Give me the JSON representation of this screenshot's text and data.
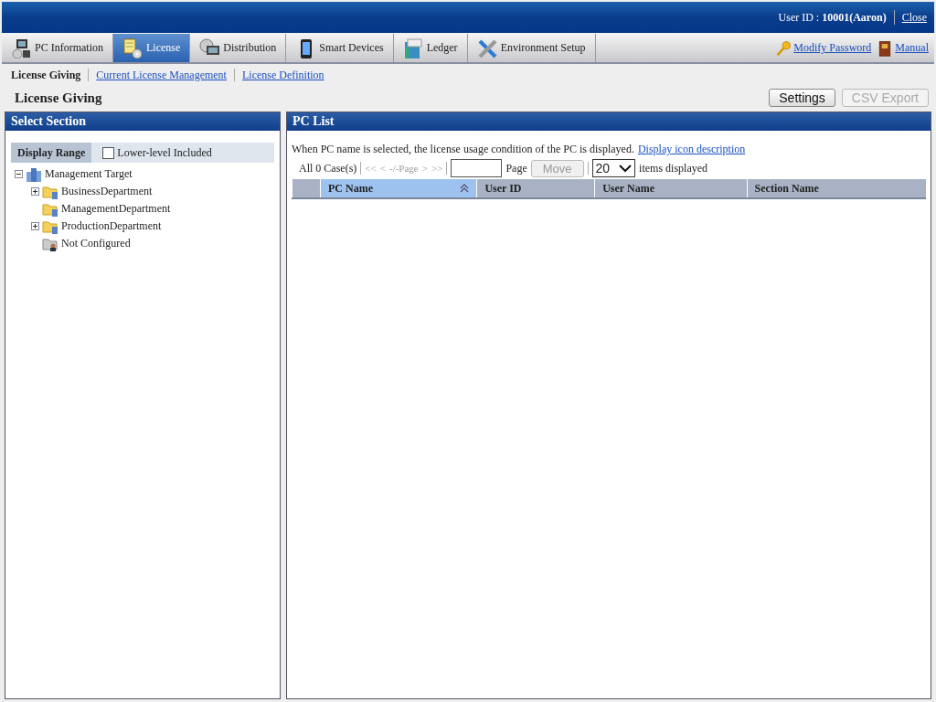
{
  "header": {
    "user": "User ID : **10001(Aaron)**",
    "close_link": "Close"
  },
  "tabs": [
    {
      "label": "PC Information",
      "selected": false
    },
    {
      "label": "License",
      "selected": true
    },
    {
      "label": "Distribution",
      "selected": false
    },
    {
      "label": "Smart Devices",
      "selected": false
    },
    {
      "label": "Ledger",
      "selected": false
    },
    {
      "label": "Environment Setup",
      "selected": false
    }
  ],
  "header_links": [
    {
      "label": "Modify Password"
    },
    {
      "label": "Manual"
    }
  ],
  "subnav": [
    {
      "label": "License Giving",
      "selected": true
    },
    {
      "label": "Current License Management",
      "selected": false
    },
    {
      "label": "License Definition",
      "selected": false
    }
  ],
  "page_title": "License Giving",
  "buttons": [
    {
      "label": "Settings",
      "disabled": false
    },
    {
      "label": "CSV Export",
      "disabled": true
    }
  ],
  "left_panel": {
    "title": "Select Section",
    "display_range": "Display Range",
    "checkbox": {
      "label": "Lower-level Included",
      "checked": false
    },
    "tree": [
      {
        "label": "Management Target",
        "kind": "root",
        "expanded": true,
        "children": [
          {
            "label": "BusinessDepartment",
            "kind": "folder",
            "expanded": false
          },
          {
            "label": "ManagementDepartment",
            "kind": "folder"
          },
          {
            "label": "ProductionDepartment",
            "kind": "folder",
            "expanded": false
          },
          {
            "label": "Not Configured",
            "kind": "unassigned"
          }
        ]
      }
    ]
  },
  "right_panel": {
    "title": "PC List",
    "hint": "When PC name is selected, the license usage condition of the PC is displayed.",
    "hint_link": "Display icon description",
    "pager": {
      "count": "All 0 Case(s)",
      "nav": [
        "<<",
        "<",
        "-/-Page",
        ">",
        ">>"
      ],
      "page_label": "Page",
      "move": {
        "label": "Move",
        "disabled": true
      },
      "page_size": "20",
      "items_label": "items displayed"
    },
    "columns": [
      {
        "label": "PC Name",
        "sorted": true
      },
      {
        "label": "User ID",
        "sorted": false
      },
      {
        "label": "User Name",
        "sorted": false
      },
      {
        "label": "Section Name",
        "sorted": false
      }
    ]
  }
}
